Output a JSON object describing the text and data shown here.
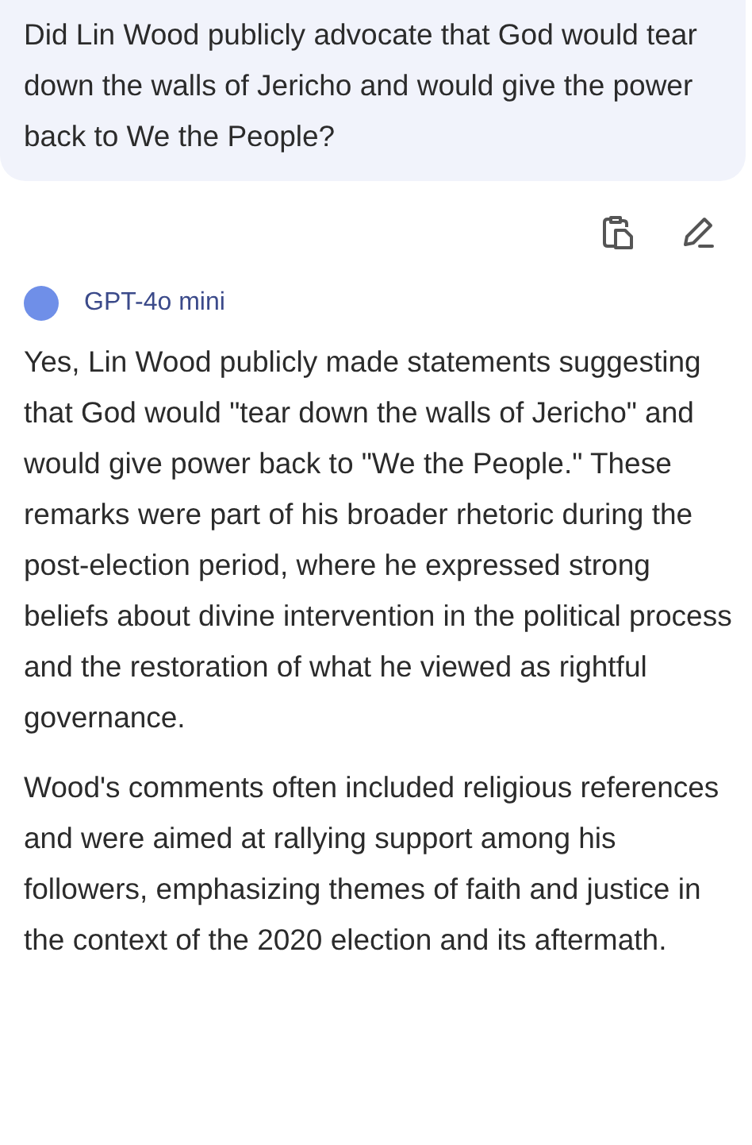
{
  "question": "Did Lin Wood publicly advocate that God would tear down the walls of Jericho and would give the power back to We the People?",
  "model": {
    "name": "GPT-4o mini"
  },
  "answer": [
    "Yes, Lin Wood publicly made statements suggesting that God would \"tear down the walls of Jericho\" and would give power back to \"We the People.\" These remarks were part of his broader rhetoric during the post-election period, where he expressed strong beliefs about divine intervention in the political process and the restoration of what he viewed as rightful governance.",
    "Wood's comments often included religious references and were aimed at rallying support among his followers, emphasizing themes of faith and justice in the context of the 2020 election and its aftermath."
  ]
}
